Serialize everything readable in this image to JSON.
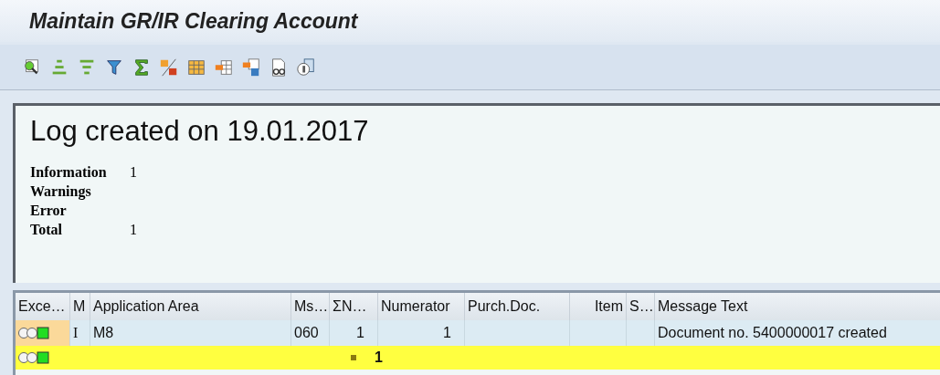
{
  "window": {
    "title": "Maintain GR/IR Clearing Account"
  },
  "log": {
    "heading": "Log created on 19.01.2017",
    "summary": [
      {
        "label": "Information",
        "value": "1"
      },
      {
        "label": "Warnings"
      },
      {
        "label": "Error"
      },
      {
        "label": "Total",
        "value": "1"
      }
    ]
  },
  "table": {
    "columns": [
      {
        "label": "Exce…"
      },
      {
        "label": "M"
      },
      {
        "label": "Application Area"
      },
      {
        "label": "Ms…"
      },
      {
        "label": "ΣN…"
      },
      {
        "label": "Numerator"
      },
      {
        "label": "Purch.Doc."
      },
      {
        "label": "Item"
      },
      {
        "label": "S…"
      },
      {
        "label": "Message Text"
      }
    ],
    "rows": [
      {
        "cells": [
          "",
          "I",
          "M8",
          "060",
          "1",
          "1",
          "",
          "",
          "",
          "Document no. 5400000017 created"
        ]
      }
    ],
    "total": {
      "value": "1"
    }
  }
}
